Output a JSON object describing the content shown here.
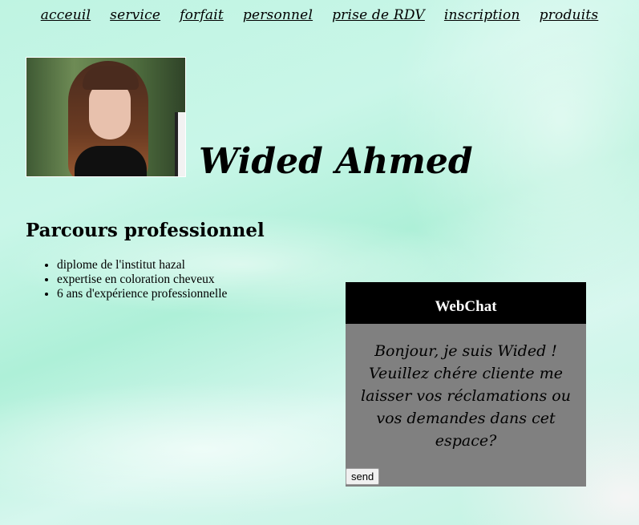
{
  "nav": {
    "items": [
      {
        "label": "acceuil"
      },
      {
        "label": "service"
      },
      {
        "label": "forfait"
      },
      {
        "label": "personnel"
      },
      {
        "label": "prise de RDV"
      },
      {
        "label": "inscription"
      },
      {
        "label": "produits"
      }
    ]
  },
  "profile": {
    "name": "Wided Ahmed"
  },
  "career": {
    "title": "Parcours professionnel",
    "items": [
      "diplome de l'institut hazal",
      "expertise en coloration cheveux",
      "6 ans d'expérience professionnelle"
    ]
  },
  "webchat": {
    "title": "WebChat",
    "message": "Bonjour, je suis Wided ! Veuillez chére cliente me laisser vos réclamations ou vos demandes dans cet espace?",
    "send_label": "send"
  }
}
